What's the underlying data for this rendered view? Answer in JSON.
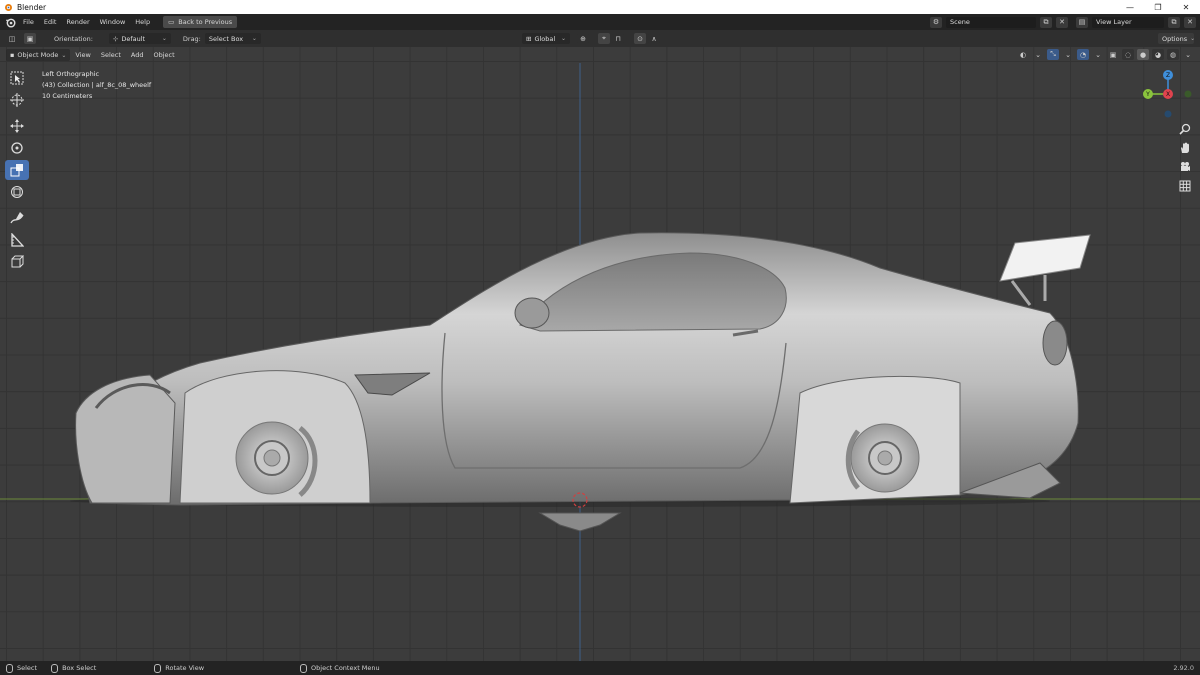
{
  "window": {
    "title": "Blender"
  },
  "menu": [
    "File",
    "Edit",
    "Render",
    "Window",
    "Help"
  ],
  "back_button": "Back to Previous",
  "scene": {
    "name": "Scene",
    "view_layer": "View Layer"
  },
  "tool_header": {
    "orientation_label": "Orientation:",
    "orientation_value": "Default",
    "drag_label": "Drag:",
    "drag_value": "Select Box",
    "transform_orientation": "Global",
    "options": "Options"
  },
  "viewport_header": {
    "mode": "Object Mode",
    "menus": [
      "View",
      "Select",
      "Add",
      "Object"
    ]
  },
  "viewport_info": {
    "view": "Left Orthographic",
    "collection": "(43) Collection | alf_8c_08_wheelf",
    "scale": "10 Centimeters"
  },
  "gizmo_axes": {
    "z": "Z",
    "y": "Y",
    "x": "X"
  },
  "status_bar": {
    "select": "Select",
    "box_select": "Box Select",
    "rotate": "Rotate View",
    "context_menu": "Object Context Menu",
    "version": "2.92.0"
  },
  "colors": {
    "active_tool": "#4772b3",
    "x_axis": "#e0434e",
    "y_axis": "#8ac33d",
    "z_axis": "#3f8fdb"
  }
}
